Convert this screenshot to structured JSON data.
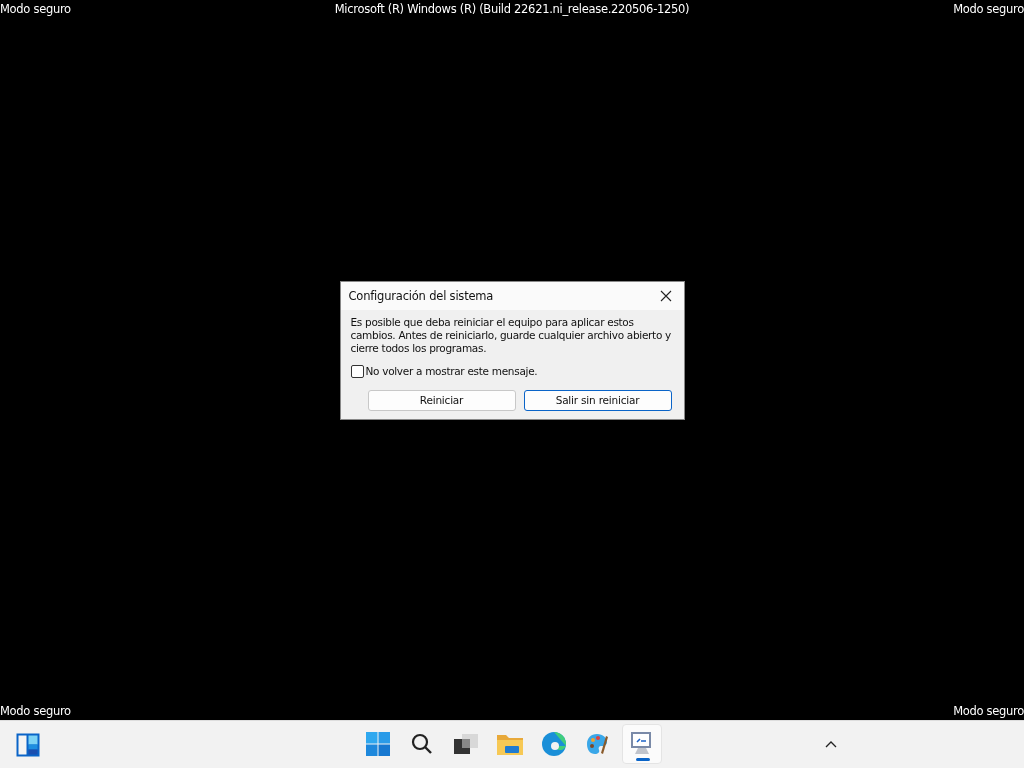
{
  "top_bar": {
    "left": "Modo seguro",
    "center": "Microsoft (R) Windows (R) (Build 22621.ni_release.220506-1250)",
    "right": "Modo seguro"
  },
  "bottom_bar": {
    "left": "Modo seguro",
    "right": "Modo seguro"
  },
  "dialog": {
    "title": "Configuración del sistema",
    "message": "Es posible que deba reiniciar el equipo para aplicar estos cambios. Antes de reiniciarlo, guarde cualquier archivo abierto y cierre todos los programas.",
    "checkbox": {
      "label": "No volver a mostrar este mensaje.",
      "checked": false
    },
    "buttons": [
      {
        "label": "Reiniciar",
        "default": false
      },
      {
        "label": "Salir sin reiniciar",
        "default": true
      }
    ]
  },
  "taskbar": {
    "apps": [
      {
        "kind": "start",
        "selected": false
      },
      {
        "kind": "search",
        "selected": false
      },
      {
        "kind": "taskview",
        "selected": false
      },
      {
        "kind": "explorer",
        "selected": false
      },
      {
        "kind": "edge",
        "selected": false
      },
      {
        "kind": "paint",
        "selected": false
      },
      {
        "kind": "sysconfig",
        "selected": true
      }
    ]
  }
}
